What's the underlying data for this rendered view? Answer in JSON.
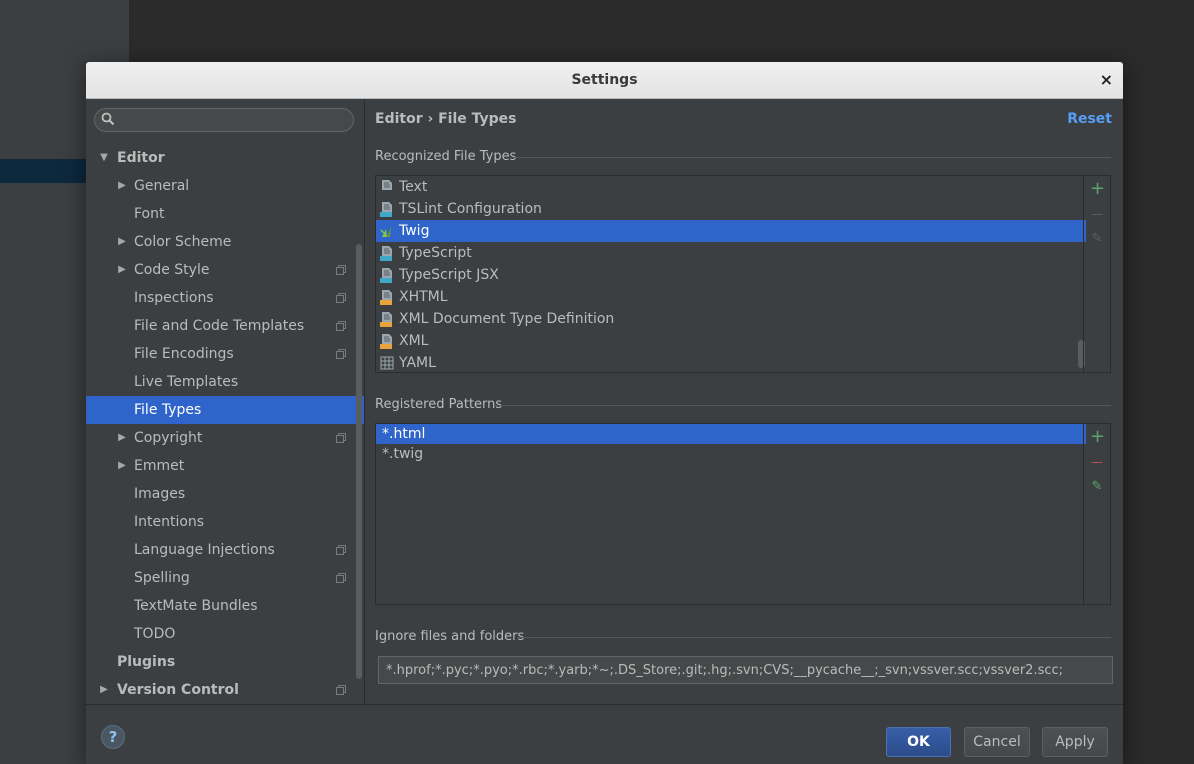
{
  "window": {
    "title": "Settings",
    "close_glyph": "×"
  },
  "search": {
    "placeholder": "",
    "value": ""
  },
  "tree": {
    "items": [
      {
        "label": "Editor",
        "level": 0,
        "expanded": true,
        "bold": true,
        "selected": false,
        "project": false
      },
      {
        "label": "General",
        "level": 1,
        "collapsed": true,
        "selected": false,
        "project": false
      },
      {
        "label": "Font",
        "level": 1,
        "selected": false,
        "project": false
      },
      {
        "label": "Color Scheme",
        "level": 1,
        "collapsed": true,
        "selected": false,
        "project": false
      },
      {
        "label": "Code Style",
        "level": 1,
        "collapsed": true,
        "selected": false,
        "project": true
      },
      {
        "label": "Inspections",
        "level": 1,
        "selected": false,
        "project": true
      },
      {
        "label": "File and Code Templates",
        "level": 1,
        "selected": false,
        "project": true
      },
      {
        "label": "File Encodings",
        "level": 1,
        "selected": false,
        "project": true
      },
      {
        "label": "Live Templates",
        "level": 1,
        "selected": false,
        "project": false
      },
      {
        "label": "File Types",
        "level": 1,
        "selected": true,
        "project": false
      },
      {
        "label": "Copyright",
        "level": 1,
        "collapsed": true,
        "selected": false,
        "project": true
      },
      {
        "label": "Emmet",
        "level": 1,
        "collapsed": true,
        "selected": false,
        "project": false
      },
      {
        "label": "Images",
        "level": 1,
        "selected": false,
        "project": false
      },
      {
        "label": "Intentions",
        "level": 1,
        "selected": false,
        "project": false
      },
      {
        "label": "Language Injections",
        "level": 1,
        "selected": false,
        "project": true
      },
      {
        "label": "Spelling",
        "level": 1,
        "selected": false,
        "project": true
      },
      {
        "label": "TextMate Bundles",
        "level": 1,
        "selected": false,
        "project": false
      },
      {
        "label": "TODO",
        "level": 1,
        "selected": false,
        "project": false
      },
      {
        "label": "Plugins",
        "level": 0,
        "bold": true,
        "selected": false,
        "project": false
      },
      {
        "label": "Version Control",
        "level": 0,
        "collapsed": true,
        "bold": true,
        "selected": false,
        "project": true
      }
    ]
  },
  "breadcrumb": {
    "text": "Editor › File Types"
  },
  "reset_label": "Reset",
  "recognized": {
    "title": "Recognized File Types",
    "items": [
      {
        "label": "Text",
        "icon": "text-file-icon",
        "color": "#9aa7b0"
      },
      {
        "label": "TSLint Configuration",
        "icon": "json-file-icon",
        "color": "#40a8c8"
      },
      {
        "label": "Twig",
        "icon": "twig-icon",
        "color": "#8bc34a",
        "selected": true
      },
      {
        "label": "TypeScript",
        "icon": "typescript-file-icon",
        "color": "#40a8c8"
      },
      {
        "label": "TypeScript JSX",
        "icon": "tsx-file-icon",
        "color": "#40a8c8"
      },
      {
        "label": "XHTML",
        "icon": "xhtml-file-icon",
        "color": "#e8a33d"
      },
      {
        "label": "XML Document Type Definition",
        "icon": "dtd-file-icon",
        "color": "#e8a33d"
      },
      {
        "label": "XML",
        "icon": "xml-file-icon",
        "color": "#e8a33d"
      },
      {
        "label": "YAML",
        "icon": "yaml-file-icon",
        "color": "#9aa7b0"
      }
    ]
  },
  "patterns": {
    "title": "Registered Patterns",
    "items": [
      {
        "label": "*.html",
        "selected": true
      },
      {
        "label": "*.twig",
        "selected": false
      }
    ]
  },
  "ignore": {
    "title": "Ignore files and folders",
    "value": "*.hprof;*.pyc;*.pyo;*.rbc;*.yarb;*~;.DS_Store;.git;.hg;.svn;CVS;__pycache__;_svn;vssver.scc;vssver2.scc;"
  },
  "toolbar": {
    "add_glyph": "+",
    "remove_glyph": "—",
    "edit_glyph": "✎"
  },
  "buttons": {
    "help": "?",
    "ok": "OK",
    "cancel": "Cancel",
    "apply": "Apply"
  },
  "colors": {
    "selection": "#2f65ca",
    "link": "#589df6",
    "add": "#59a869",
    "remove": "#c75450"
  }
}
